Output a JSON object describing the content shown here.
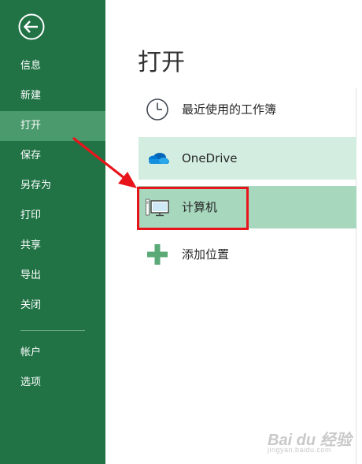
{
  "sidebar": {
    "back_label": "back",
    "items": [
      {
        "label": "信息",
        "active": false
      },
      {
        "label": "新建",
        "active": false
      },
      {
        "label": "打开",
        "active": true
      },
      {
        "label": "保存",
        "active": false
      },
      {
        "label": "另存为",
        "active": false
      },
      {
        "label": "打印",
        "active": false
      },
      {
        "label": "共享",
        "active": false
      },
      {
        "label": "导出",
        "active": false
      },
      {
        "label": "关闭",
        "active": false
      }
    ],
    "bottom_items": [
      {
        "label": "帐户"
      },
      {
        "label": "选项"
      }
    ]
  },
  "main": {
    "title": "打开",
    "locations": [
      {
        "label": "最近使用的工作簿",
        "icon": "clock-icon"
      },
      {
        "label": "OneDrive",
        "icon": "cloud-icon"
      },
      {
        "label": "计算机",
        "icon": "computer-icon",
        "selected": true
      },
      {
        "label": "添加位置",
        "icon": "plus-icon"
      }
    ]
  },
  "colors": {
    "sidebar": "#217346",
    "sidebar_active": "#4b9a6e",
    "onedrive_row": "#d3eee0",
    "computer_row": "#a7d7bd",
    "annotation_red": "#e8141b"
  },
  "watermark": {
    "main": "Bai du 经验",
    "sub": "jingyan.baidu.com"
  }
}
